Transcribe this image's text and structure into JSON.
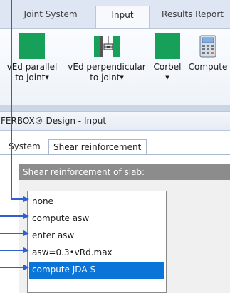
{
  "ribbon_tabs": [
    "Joint System",
    "Input",
    "Results Report"
  ],
  "active_ribbon_tab": "Input",
  "ribbon_buttons": [
    {
      "line1": "vEd parallel",
      "line2": "to joint",
      "has_dropdown": true,
      "icon": "green-square-icon"
    },
    {
      "line1": "vEd perpendicular",
      "line2": "to joint",
      "has_dropdown": true,
      "icon": "joint-perpendicular-icon"
    },
    {
      "line1": "Corbel",
      "line2": "",
      "has_dropdown": true,
      "icon": "green-square-icon"
    },
    {
      "line1": "Compute",
      "line2": "",
      "has_dropdown": false,
      "icon": "calculator-icon"
    }
  ],
  "panel_title": "FERBOX® Design - Input",
  "inner_tabs": [
    "System",
    "Shear reinforcement"
  ],
  "active_inner_tab": "Shear reinforcement",
  "section_header": "Shear reinforcement of slab:",
  "options": [
    "none",
    "compute asw",
    "enter asw",
    "asw=0.3•vRd.max",
    "compute JDA-S"
  ],
  "selected_option": "compute JDA-S",
  "colors": {
    "accent_green": "#17a05a",
    "selection_blue": "#0a74d8",
    "annotation_blue": "#2f5fd0",
    "section_header_gray": "#8c8c8c",
    "ribbon_tab_bg": "#dde6f2"
  }
}
